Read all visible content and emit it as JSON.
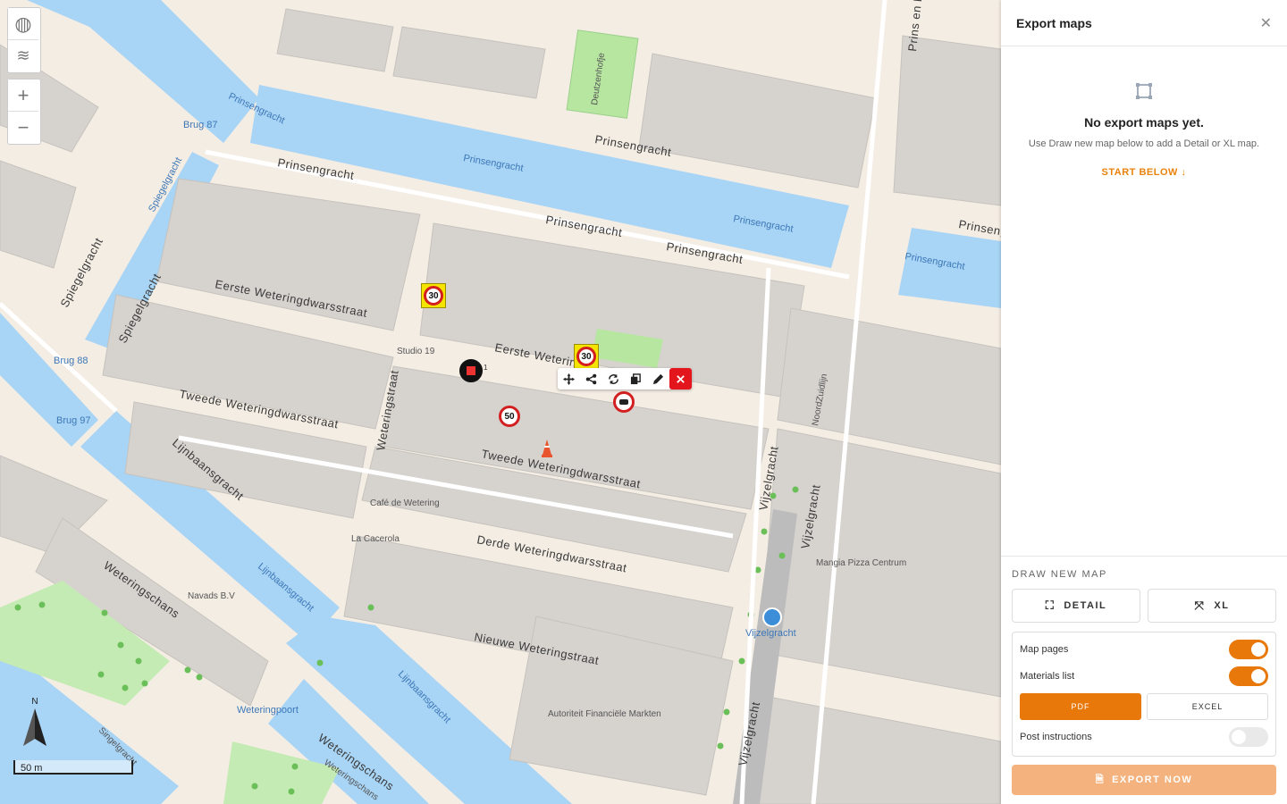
{
  "map": {
    "streets": {
      "prinsengracht_1": "Prinsengracht",
      "prinsengracht_2": "Prinsengracht",
      "prinsengracht_3": "Prinsengracht",
      "prinsengracht_4": "Prinsengracht",
      "prinsengracht_5": "Prinsengracht",
      "eerste": "Eerste Weteringdwarsstraat",
      "eerste_2": "Eerste Wetering",
      "tweede": "Tweede Weteringdwarsstraat",
      "tweede_2": "Tweede Weteringdwarsstraat",
      "derde": "Derde Weteringdwarsstraat",
      "nieuwe": "Nieuwe Weteringstraat",
      "weteringstraat": "Weteringstraat",
      "spiegelgracht_1": "Spiegelgracht",
      "spiegelgracht_2": "Spiegelgracht",
      "lijnbaansgracht": "Lijnbaansgracht",
      "lijnbaansgracht_2": "Lijnbaansgracht",
      "lijnbaansgracht_3": "Lijnbaansgracht",
      "weteringschans_1": "Weteringschans",
      "weteringschans_2": "Weteringschans",
      "vijzelgracht_1": "Vijzelgracht",
      "vijzelgracht_2": "Vijzelgracht",
      "vijzelgracht_3": "Vijzelgracht",
      "prins_en_keizer": "Prins en Keizer",
      "noord_zuidlijn": "NoordZuidlijn",
      "weteringschans_3": "Weteringschans",
      "singelgracht": "Singelgracht"
    },
    "canals": {
      "c1": "Prinsengracht",
      "c2": "Prinsengracht",
      "c3": "Prinsengracht",
      "c4": "Prinsengracht",
      "c5": "Spiegelgracht",
      "c6": "Lijnbaansgracht",
      "c7": "Lijnbaansgracht",
      "c8": "Brug 87",
      "c9": "Brug 88",
      "c10": "Brug 97"
    },
    "pois": {
      "studio": "Studio 19",
      "cafe": "Café de Wetering",
      "caserola": "La Cacerola",
      "navads": "Navads B.V",
      "mangia": "Mangia Pizza Centrum",
      "autoriteit": "Autoriteit Financiële Markten",
      "weteringpoort": "Weteringpoort",
      "vijzelgracht_stop": "Vijzelgracht",
      "deutzenhofje": "Deutzenhofje"
    },
    "signs": {
      "s30a": "30",
      "s30b": "30",
      "s50": "50",
      "badge_count": "1"
    },
    "compass_label": "N",
    "scale_label": "50 m"
  },
  "panel": {
    "title": "Export maps",
    "empty_title": "No export maps yet.",
    "empty_sub": "Use Draw new map below to add a Detail or XL map.",
    "start_below": "START BELOW",
    "draw_title": "DRAW NEW MAP",
    "detail_label": "DETAIL",
    "xl_label": "XL",
    "map_pages_label": "Map pages",
    "materials_label": "Materials list",
    "pdf_label": "PDF",
    "excel_label": "EXCEL",
    "post_instructions_label": "Post instructions",
    "export_label": "EXPORT NOW",
    "map_pages_on": true,
    "materials_on": true,
    "post_instructions_on": false,
    "accent": "#e8780a"
  }
}
